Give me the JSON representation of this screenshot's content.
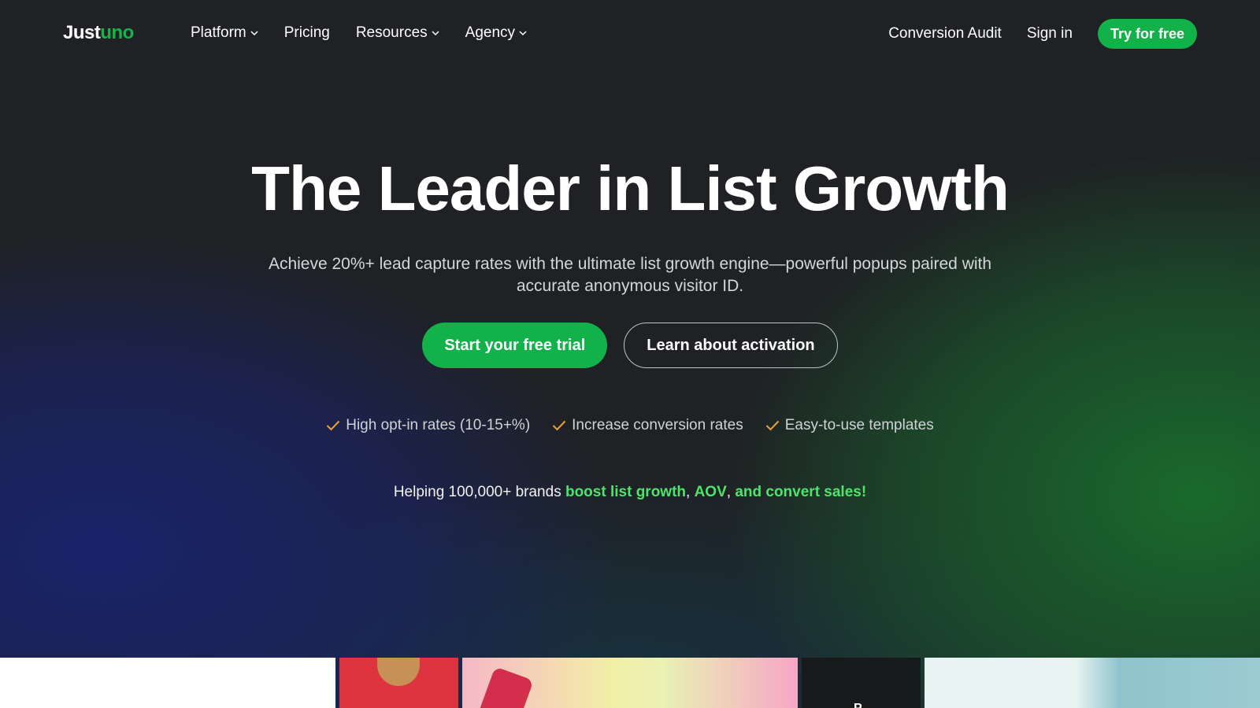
{
  "brand": {
    "logo_part1": "Just",
    "logo_part2": "uno"
  },
  "nav": {
    "items": [
      {
        "label": "Platform",
        "has_dropdown": true
      },
      {
        "label": "Pricing",
        "has_dropdown": false
      },
      {
        "label": "Resources",
        "has_dropdown": true
      },
      {
        "label": "Agency",
        "has_dropdown": true
      }
    ],
    "conversion_audit": "Conversion Audit",
    "sign_in": "Sign in",
    "try_free": "Try for free"
  },
  "hero": {
    "title": "The Leader in List Growth",
    "subtitle": "Achieve 20%+ lead capture rates with the ultimate list growth engine—powerful popups paired with accurate anonymous visitor ID.",
    "primary_cta": "Start your free trial",
    "secondary_cta": "Learn about activation",
    "features": [
      "High opt-in rates (10-15+%)",
      "Increase conversion rates",
      "Easy-to-use templates"
    ],
    "helping": {
      "prefix": "Helping 100,000+ brands ",
      "hl1": "boost list growth",
      "sep1": ", ",
      "hl2": "AOV",
      "sep2": ", ",
      "hl3": "and convert sales!"
    }
  },
  "strip": {
    "card4_text": "P"
  },
  "colors": {
    "accent": "#12b14a",
    "highlight": "#4ee36c",
    "check": "#e9a23b",
    "background": "#1f2124"
  }
}
